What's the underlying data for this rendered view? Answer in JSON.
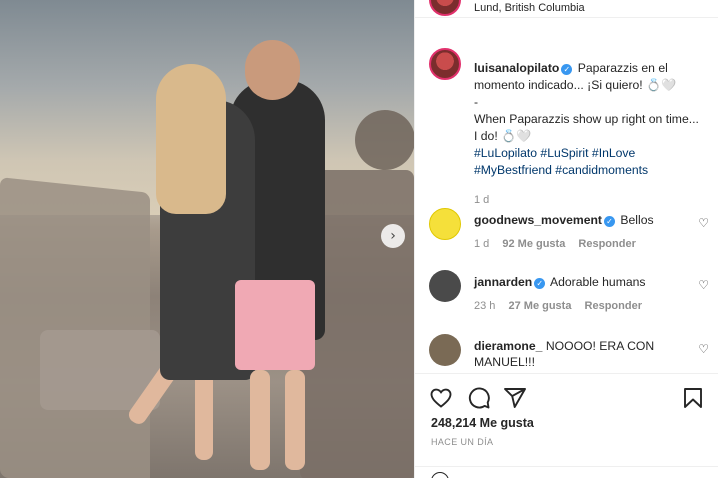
{
  "header": {
    "location": "Lund, British Columbia"
  },
  "caption": {
    "username": "luisanalopilato",
    "text_es": "Paparazzis en el momento indicado... ¡Si quiero! 💍🤍",
    "dash": "-",
    "text_en": "When Paparazzis show up right on time... I do! 💍🤍",
    "hashtags": [
      "#LuLopilato",
      "#LuSpirit",
      "#InLove",
      "#MyBestfriend",
      "#candidmoments"
    ],
    "time": "1 d"
  },
  "comments": [
    {
      "username": "goodnews_movement",
      "text": "Bellos",
      "time": "1 d",
      "likes": "92 Me gusta",
      "reply": "Responder",
      "avatar_color": "#f5e03a"
    },
    {
      "username": "jannarden",
      "text": "Adorable humans",
      "time": "23 h",
      "likes": "27 Me gusta",
      "reply": "Responder",
      "avatar_color": "#4a4a4a"
    },
    {
      "username": "dieramone_",
      "text": "NOOOO! ERA CON MANUEL!!!",
      "avatar_color": "#7a6a55"
    }
  ],
  "actions": {
    "likes": "248,214 Me gusta",
    "posted": "HACE UN DÍA"
  },
  "icons": {
    "like": "heart-icon",
    "comment": "comment-icon",
    "share": "send-icon",
    "save": "bookmark-icon",
    "next": "chevron-right-icon"
  },
  "colors": {
    "link": "#00376b",
    "verified": "#3897f0",
    "muted": "#8e8e8e"
  }
}
